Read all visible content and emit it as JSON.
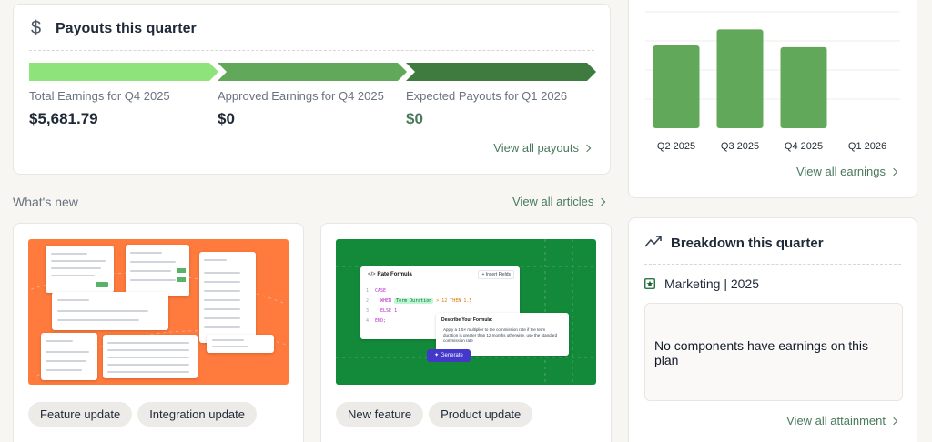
{
  "payouts": {
    "title": "Payouts this quarter",
    "icon": "dollar-icon",
    "stats": [
      {
        "label": "Total Earnings for Q4 2025",
        "value": "$5,681.79",
        "color": "#1f2937"
      },
      {
        "label": "Approved Earnings for Q4 2025",
        "value": "$0",
        "color": "#1f2937"
      },
      {
        "label": "Expected Payouts for Q1 2026",
        "value": "$0",
        "color": "#4a7a5c"
      }
    ],
    "stage_colors": [
      "#8ee47a",
      "#62a85a",
      "#3f7a3e"
    ],
    "view_all": "View all payouts"
  },
  "earnings": {
    "view_all": "View all earnings"
  },
  "chart_data": {
    "type": "bar",
    "categories": [
      "Q2 2025",
      "Q3 2025",
      "Q4 2025",
      "Q1 2026"
    ],
    "values": [
      4900,
      5850,
      4800,
      0
    ],
    "ylim": [
      0,
      7000
    ],
    "grid": true,
    "bar_color": "#62a85a"
  },
  "whats_new": {
    "title": "What's new",
    "view_all": "View all articles",
    "articles": [
      {
        "tags": [
          "Feature update",
          "Integration update"
        ],
        "thumb_bg": "#ff7a3d"
      },
      {
        "tags": [
          "New feature",
          "Product update"
        ],
        "thumb_bg": "#128a3a",
        "thumb": {
          "panel_title": "Rate Formula",
          "insert_fields": "+ Insert Fields",
          "code": [
            "CASE",
            "WHEN",
            "Term Duration",
            "> 12 THEN 1.5",
            "ELSE 1",
            "END;"
          ],
          "describe_title": "Describe Your Formula:",
          "describe_text": "Apply a 1.5× multiplier to the commission rate if the term duration is greater than 12 months otherwise, use the standard commission rate",
          "generate": "Generate"
        }
      }
    ]
  },
  "breakdown": {
    "title": "Breakdown this quarter",
    "icon": "trend-up-icon",
    "plan": "Marketing | 2025",
    "plan_icon": "star-square-icon",
    "empty_text": "No components have earnings on this plan",
    "view_all": "View all attainment"
  }
}
